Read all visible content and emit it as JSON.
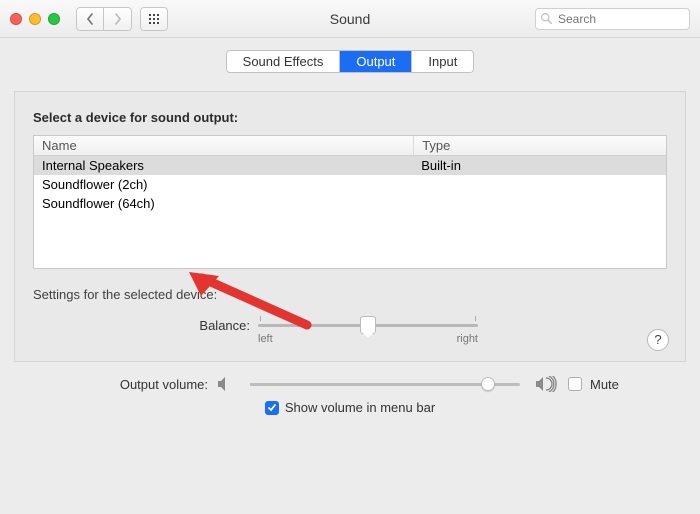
{
  "window": {
    "title": "Sound"
  },
  "search": {
    "placeholder": "Search"
  },
  "tabs": [
    {
      "label": "Sound Effects",
      "active": false
    },
    {
      "label": "Output",
      "active": true
    },
    {
      "label": "Input",
      "active": false
    }
  ],
  "output": {
    "heading": "Select a device for sound output:",
    "columns": {
      "name": "Name",
      "type": "Type"
    },
    "devices": [
      {
        "name": "Internal Speakers",
        "type": "Built-in",
        "selected": true
      },
      {
        "name": "Soundflower (2ch)",
        "type": "",
        "selected": false
      },
      {
        "name": "Soundflower (64ch)",
        "type": "",
        "selected": false
      }
    ]
  },
  "settings": {
    "heading": "Settings for the selected device:",
    "balance": {
      "label": "Balance:",
      "leftLabel": "left",
      "rightLabel": "right",
      "value": 50
    }
  },
  "footer": {
    "volume": {
      "label": "Output volume:",
      "value": 88
    },
    "mute": {
      "label": "Mute",
      "checked": false
    },
    "menubar": {
      "label": "Show volume in menu bar",
      "checked": true
    }
  },
  "help": {
    "glyph": "?"
  },
  "accent": "#1b6ef3"
}
